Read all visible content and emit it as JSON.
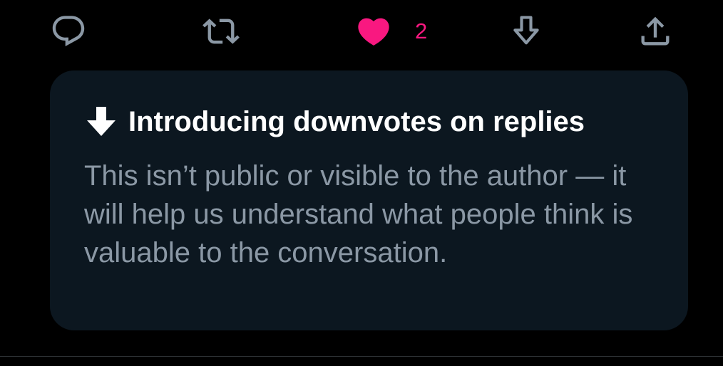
{
  "actions": {
    "reply": {
      "icon": "reply-icon"
    },
    "retweet": {
      "icon": "retweet-icon"
    },
    "like": {
      "icon": "heart-icon",
      "count": "2",
      "active": true,
      "color": "#f91880"
    },
    "downvote": {
      "icon": "arrow-down-icon"
    },
    "share": {
      "icon": "share-icon"
    }
  },
  "notice": {
    "icon": "arrow-down-icon",
    "title": "Introducing downvotes on replies",
    "body": "This isn’t public or visible to the author — it will help us understand what people think is valuable to the conversation."
  },
  "colors": {
    "background": "#000000",
    "card": "#0c1720",
    "icon": "#8b98a5",
    "like": "#f91880",
    "title": "#ffffff",
    "body": "#8b98a5"
  }
}
